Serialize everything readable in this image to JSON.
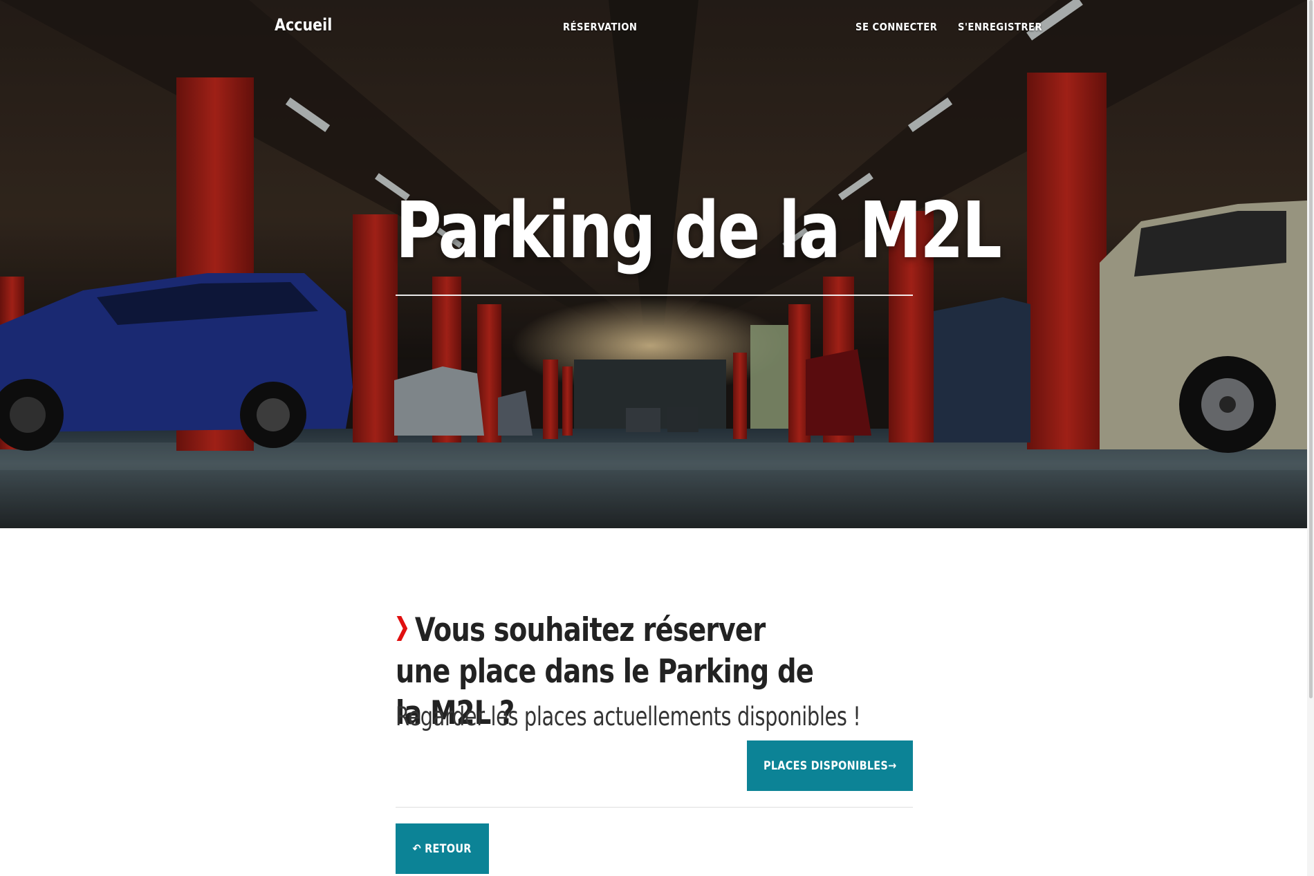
{
  "nav": {
    "brand": "Accueil",
    "reservation": "RÉSERVATION",
    "login": "SE CONNECTER",
    "register": "S'ENREGISTRER"
  },
  "hero": {
    "title": "Parking de la M2L"
  },
  "content": {
    "heading": "Vous souhaitez réserver une place dans le Parking de la M2L ?",
    "subheading": "Regarder les places actuellements disponibles !",
    "available_button": "PLACES DISPONIBLES→",
    "back_button": "↶ RETOUR"
  },
  "colors": {
    "accent_button": "#0c8396",
    "chevron": "#e01010",
    "pillar_red": "#b8231a"
  },
  "icons": {
    "chevron": "chevron-right-icon"
  }
}
